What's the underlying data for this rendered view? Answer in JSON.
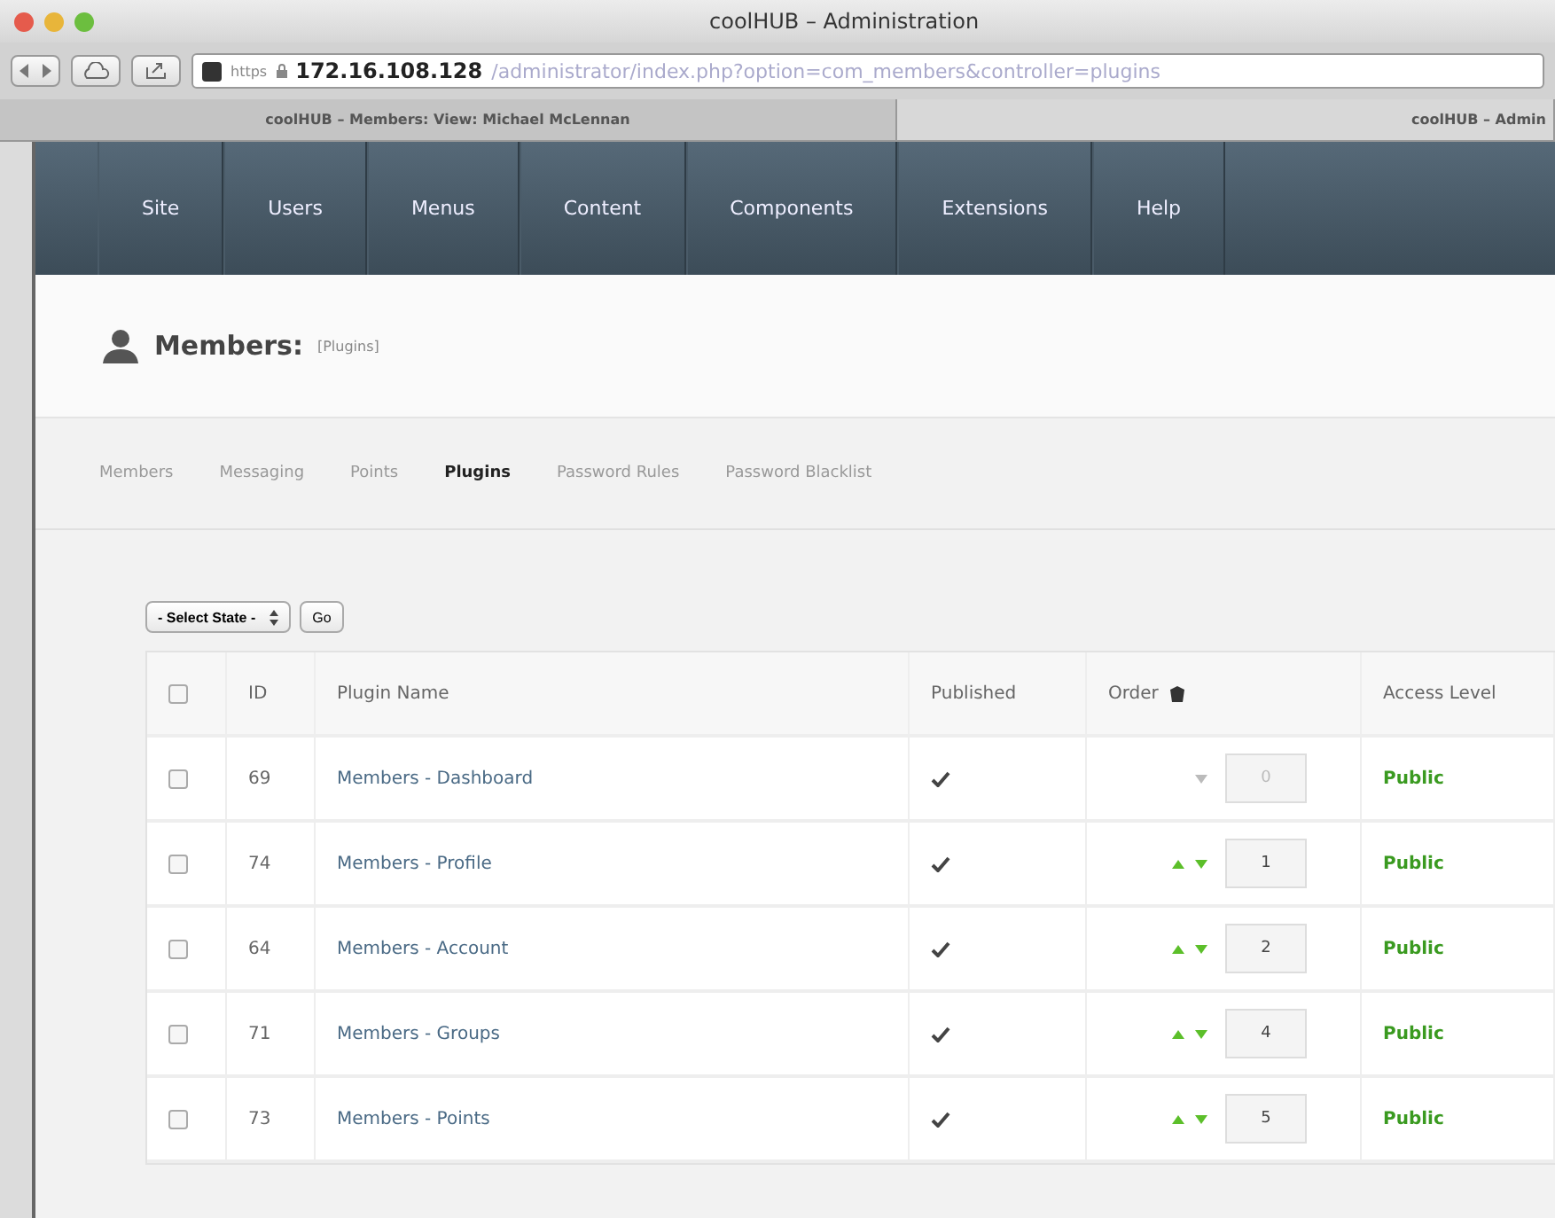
{
  "window": {
    "title": "coolHUB – Administration"
  },
  "address_bar": {
    "scheme": "https",
    "host": "172.16.108.128",
    "path": "/administrator/index.php?option=com_members&controller=plugins"
  },
  "browser_tabs": [
    {
      "label": "coolHUB – Members: View: Michael McLennan",
      "selected": false
    },
    {
      "label": "coolHUB – Admin",
      "selected": true
    }
  ],
  "menu": [
    "Site",
    "Users",
    "Menus",
    "Content",
    "Components",
    "Extensions",
    "Help"
  ],
  "page_title": {
    "title": "Members:",
    "subtitle": "[Plugins]"
  },
  "subnav": [
    {
      "label": "Members",
      "selected": false
    },
    {
      "label": "Messaging",
      "selected": false
    },
    {
      "label": "Points",
      "selected": false
    },
    {
      "label": "Plugins",
      "selected": true
    },
    {
      "label": "Password Rules",
      "selected": false
    },
    {
      "label": "Password Blacklist",
      "selected": false
    }
  ],
  "filter": {
    "select": "- Select State -",
    "button": "Go"
  },
  "table": {
    "columns": [
      "ID",
      "Plugin Name",
      "Published",
      "Order",
      "Access Level"
    ],
    "all_checked": false,
    "rows": [
      {
        "checked": false,
        "id": "69",
        "name": "Members - Dashboard",
        "published": true,
        "can_move_up": false,
        "can_move_down": true,
        "order": "0",
        "order_disabled": true,
        "access": "Public"
      },
      {
        "checked": false,
        "id": "74",
        "name": "Members - Profile",
        "published": true,
        "can_move_up": true,
        "can_move_down": true,
        "order": "1",
        "order_disabled": false,
        "access": "Public"
      },
      {
        "checked": false,
        "id": "64",
        "name": "Members - Account",
        "published": true,
        "can_move_up": true,
        "can_move_down": true,
        "order": "2",
        "order_disabled": false,
        "access": "Public"
      },
      {
        "checked": false,
        "id": "71",
        "name": "Members - Groups",
        "published": true,
        "can_move_up": true,
        "can_move_down": true,
        "order": "4",
        "order_disabled": false,
        "access": "Public"
      },
      {
        "checked": false,
        "id": "73",
        "name": "Members - Points",
        "published": true,
        "can_move_up": true,
        "can_move_down": true,
        "order": "5",
        "order_disabled": false,
        "access": "Public"
      }
    ]
  }
}
